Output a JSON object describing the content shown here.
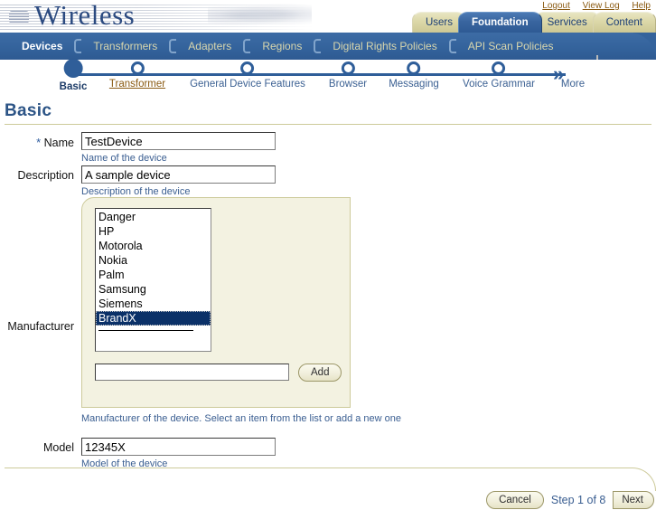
{
  "brand": {
    "logo_text": "Wireless",
    "accent_blue": "#2b4a80",
    "tab_khaki": "#ddd9aa",
    "tab_active_blue": "#34639c",
    "link_brown": "#8a5a12"
  },
  "util_links": [
    {
      "label": "Logout"
    },
    {
      "label": "View Log"
    },
    {
      "label": "Help"
    }
  ],
  "primary_tabs": [
    {
      "label": "Users",
      "active": false
    },
    {
      "label": "Foundation",
      "active": true
    },
    {
      "label": "Services",
      "active": false
    },
    {
      "label": "Content",
      "active": false
    }
  ],
  "sub_tabs": [
    {
      "label": "Devices",
      "active": true
    },
    {
      "label": "Transformers",
      "active": false
    },
    {
      "label": "Adapters",
      "active": false
    },
    {
      "label": "Regions",
      "active": false
    },
    {
      "label": "Digital Rights Policies",
      "active": false
    },
    {
      "label": "API Scan Policies",
      "active": false
    }
  ],
  "wizard": {
    "more_label": "More",
    "arrow_icon": "double-chevron-right",
    "steps": [
      {
        "label": "Basic",
        "state": "current"
      },
      {
        "label": "Transformer",
        "state": "link"
      },
      {
        "label": "General Device Features",
        "state": "pending"
      },
      {
        "label": "Browser",
        "state": "pending"
      },
      {
        "label": "Messaging",
        "state": "pending"
      },
      {
        "label": "Voice Grammar",
        "state": "pending"
      }
    ]
  },
  "page": {
    "title": "Basic"
  },
  "form": {
    "name": {
      "label": "Name",
      "required_marker": "*",
      "value": "TestDevice",
      "placeholder": "",
      "hint": "Name of the device"
    },
    "description": {
      "label": "Description",
      "value": "A sample device",
      "placeholder": "",
      "hint": "Description of the device"
    },
    "manufacturer": {
      "label": "Manufacturer",
      "hint": "Manufacturer of the device. Select an item from the list or add a new one",
      "options": [
        "Danger",
        "HP",
        "Motorola",
        "Nokia",
        "Palm",
        "Samsung",
        "Siemens",
        "BrandX"
      ],
      "selected": "BrandX",
      "add_input_value": "",
      "add_input_placeholder": "",
      "add_button_label": "Add"
    },
    "model": {
      "label": "Model",
      "value": "12345X",
      "placeholder": "",
      "hint": "Model of the device"
    }
  },
  "footer": {
    "cancel_label": "Cancel",
    "step_text": "Step 1 of 8",
    "next_label": "Next"
  }
}
